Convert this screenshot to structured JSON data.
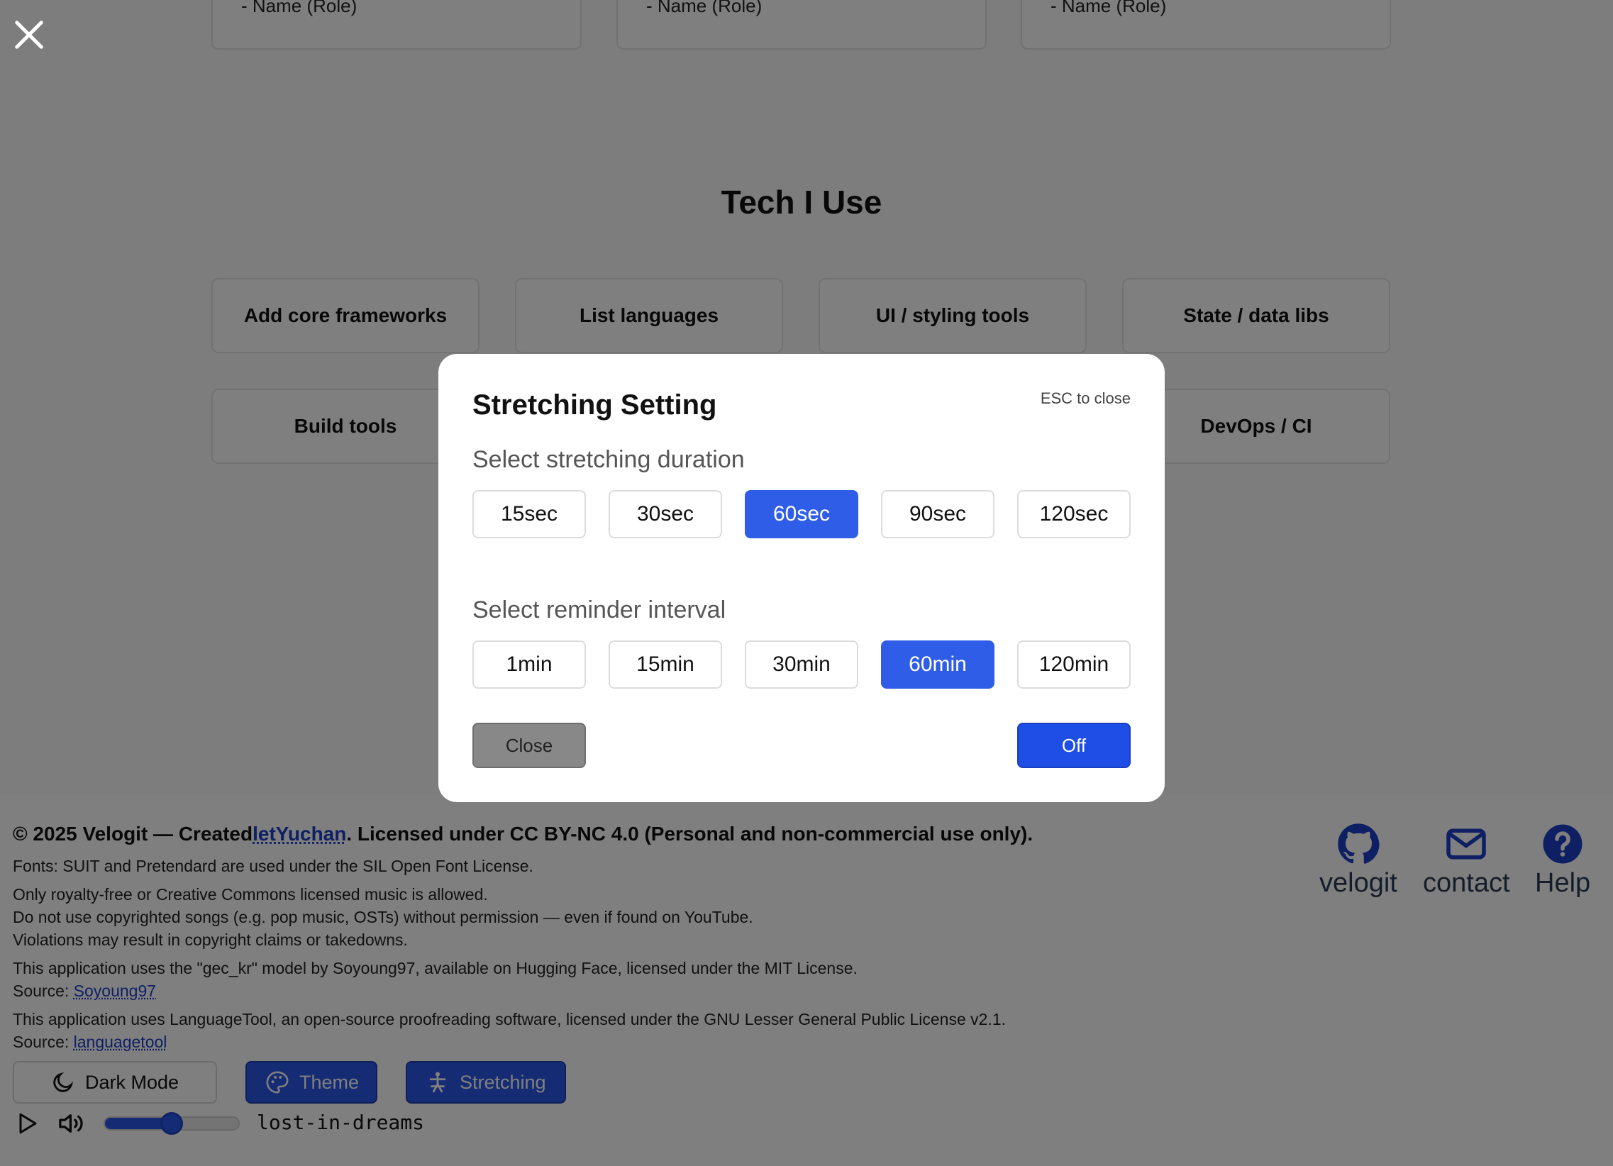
{
  "team": {
    "members": [
      {
        "label": "- Name (Role)"
      },
      {
        "label": "- Name (Role)"
      },
      {
        "label": "- Name (Role)"
      }
    ]
  },
  "tech": {
    "title": "Tech I Use",
    "cards": [
      {
        "label": "Add core frameworks"
      },
      {
        "label": "List languages"
      },
      {
        "label": "UI / styling tools"
      },
      {
        "label": "State / data libs"
      },
      {
        "label": "Build tools"
      },
      {
        "label": "DevOps / CI"
      }
    ]
  },
  "footer": {
    "copyright_prefix": "© 2025 Velogit — Created",
    "author_link": "letYuchan",
    "copyright_suffix": ". Licensed under CC BY-NC 4.0 (Personal and non-commercial use only).",
    "fonts_line": "Fonts: SUIT and Pretendard are used under the SIL Open Font License.",
    "music_line1": "Only royalty-free or Creative Commons licensed music is allowed.",
    "music_line2": "Do not use copyrighted songs (e.g. pop music, OSTs) without permission — even if found on YouTube.",
    "music_line3": "Violations may result in copyright claims or takedowns.",
    "model_line": "This application uses the \"gec_kr\" model by Soyoung97, available on Hugging Face, licensed under the MIT License.",
    "source_label": "Source:",
    "model_source_link": "Soyoung97",
    "lt_line": "This application uses LanguageTool, an open-source proofreading software, licensed under the GNU Lesser General Public License v2.1.",
    "lt_source_link": "languagetool",
    "social": [
      {
        "label": "velogit",
        "icon": "github-icon"
      },
      {
        "label": "contact",
        "icon": "mail-icon"
      },
      {
        "label": "Help",
        "icon": "help-icon"
      }
    ]
  },
  "controls": {
    "dark_mode_label": "Dark Mode",
    "theme_label": "Theme",
    "stretching_label": "Stretching",
    "track_name": "lost-in-dreams",
    "volume_percent": 50
  },
  "modal": {
    "title": "Stretching Setting",
    "esc_hint": "ESC to close",
    "duration_label": "Select stretching duration",
    "durations": [
      "15sec",
      "30sec",
      "60sec",
      "90sec",
      "120sec"
    ],
    "selected_duration": "60sec",
    "interval_label": "Select reminder interval",
    "intervals": [
      "1min",
      "15min",
      "30min",
      "60min",
      "120min"
    ],
    "selected_interval": "60min",
    "close_label": "Close",
    "off_label": "Off"
  },
  "colors": {
    "accent": "#2f5de8",
    "overlay": "rgba(0,0,0,0.5)",
    "link": "#1d3fc8"
  }
}
